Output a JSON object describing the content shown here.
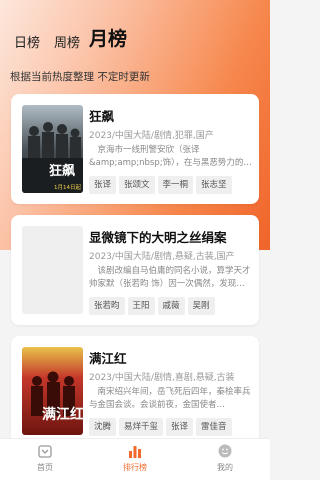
{
  "tabs": {
    "day": "日榜",
    "week": "周榜",
    "month": "月榜"
  },
  "subtitle": "根据当前热度整理 不定时更新",
  "items": [
    {
      "title": "狂飙",
      "meta": "2023/中国大陆/剧情,犯罪,国产",
      "desc": "京海市一线刑警安欣（张译&amp;amp;nbsp;饰），在与黑恶势力的…",
      "actors": [
        "张译",
        "张颂文",
        "李一桐",
        "张志坚"
      ],
      "poster_text": "狂飙",
      "poster_date": "1月14日起"
    },
    {
      "title": "显微镜下的大明之丝绢案",
      "meta": "2023/中国大陆/剧情,悬疑,古装,国产",
      "desc": "该剧改编自马伯庸的同名小说，算学天才帅家默（张若昀 饰）因一次偶然，发现…",
      "actors": [
        "张若昀",
        "王阳",
        "戚薇",
        "吴刚"
      ],
      "poster_text": "",
      "poster_date": ""
    },
    {
      "title": "满江红",
      "meta": "2023/中国大陆/剧情,喜剧,悬疑,古装",
      "desc": "南宋绍兴年间，岳飞死后四年，秦桧率兵与金国会谈。会谈前夜，金国使者…",
      "actors": [
        "沈腾",
        "易烊千玺",
        "张译",
        "雷佳音"
      ],
      "poster_text": "满江红",
      "poster_date": ""
    }
  ],
  "tabbar": {
    "home": "首页",
    "ranking": "排行榜",
    "mine": "我的"
  },
  "colors": {
    "accent": "#f26a2c"
  }
}
